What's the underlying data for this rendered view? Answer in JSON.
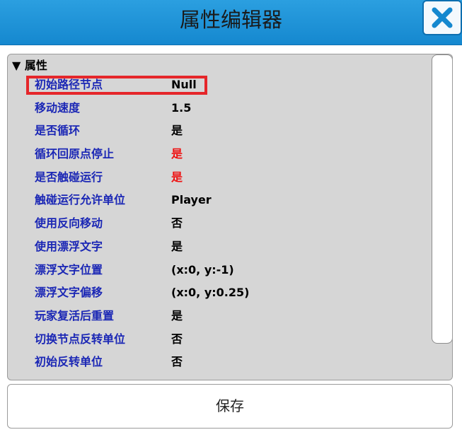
{
  "window": {
    "title": "属性编辑器"
  },
  "section": {
    "toggle_glyph": "▼",
    "label": "属性"
  },
  "properties": [
    {
      "key": "初始路径节点",
      "value": "Null",
      "value_color": "black",
      "highlighted": true
    },
    {
      "key": "移动速度",
      "value": "1.5",
      "value_color": "black"
    },
    {
      "key": "是否循环",
      "value": "是",
      "value_color": "black"
    },
    {
      "key": "循环回原点停止",
      "value": "是",
      "value_color": "red"
    },
    {
      "key": "是否触碰运行",
      "value": "是",
      "value_color": "red"
    },
    {
      "key": "触碰运行允许单位",
      "value": "Player",
      "value_color": "black"
    },
    {
      "key": "使用反向移动",
      "value": "否",
      "value_color": "black"
    },
    {
      "key": "使用漂浮文字",
      "value": "是",
      "value_color": "black"
    },
    {
      "key": "漂浮文字位置",
      "value": "(x:0, y:-1)",
      "value_color": "black"
    },
    {
      "key": "漂浮文字偏移",
      "value": "(x:0, y:0.25)",
      "value_color": "black"
    },
    {
      "key": "玩家复活后重置",
      "value": "是",
      "value_color": "black"
    },
    {
      "key": "切换节点反转单位",
      "value": "否",
      "value_color": "black"
    },
    {
      "key": "初始反转单位",
      "value": "否",
      "value_color": "black"
    }
  ],
  "footer": {
    "save_label": "保存"
  },
  "colors": {
    "titlebar": "#1a90d6",
    "key_text": "#1b27b5",
    "value_red": "#ee1111",
    "highlight_border": "#e5262a",
    "panel_bg": "#d6d6d6"
  },
  "icons": {
    "close": "close-x-icon"
  }
}
